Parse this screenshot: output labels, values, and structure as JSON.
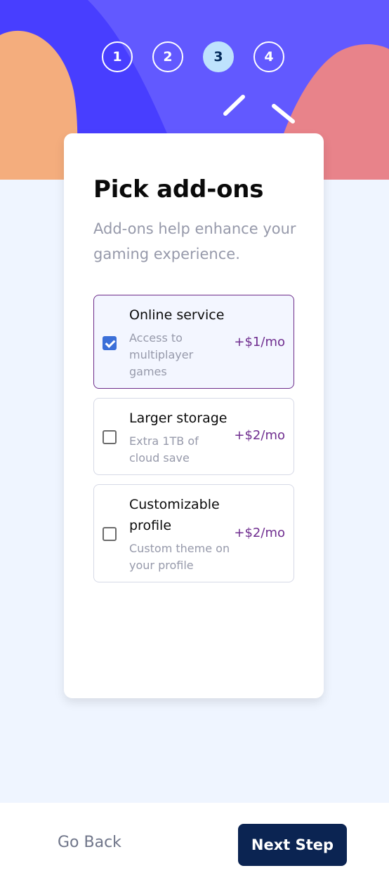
{
  "steps": [
    "1",
    "2",
    "3",
    "4"
  ],
  "active_step": "3",
  "page": {
    "title": "Pick add-ons",
    "subtitle": "Add-ons help enhance your gaming experience."
  },
  "addons": [
    {
      "name": "Online service",
      "description": "Access to multiplayer games",
      "price": "+$1/mo",
      "selected": true
    },
    {
      "name": "Larger storage",
      "description": "Extra 1TB of cloud save",
      "price": "+$2/mo",
      "selected": false
    },
    {
      "name": "Customizable profile",
      "description": "Custom theme on your profile",
      "price": "+$2/mo",
      "selected": false
    }
  ],
  "footer": {
    "back_label": "Go Back",
    "next_label": "Next Step"
  },
  "colors": {
    "hero_blue": "#483eff",
    "active_step_bg": "#bee2fd",
    "orange_blob": "#f4ad7d",
    "pink_blob": "#e8838a",
    "selected_border": "#6d2c8a",
    "price_purple": "#6f2d8f",
    "next_button": "#0b2452",
    "page_bg": "#eff5ff"
  }
}
